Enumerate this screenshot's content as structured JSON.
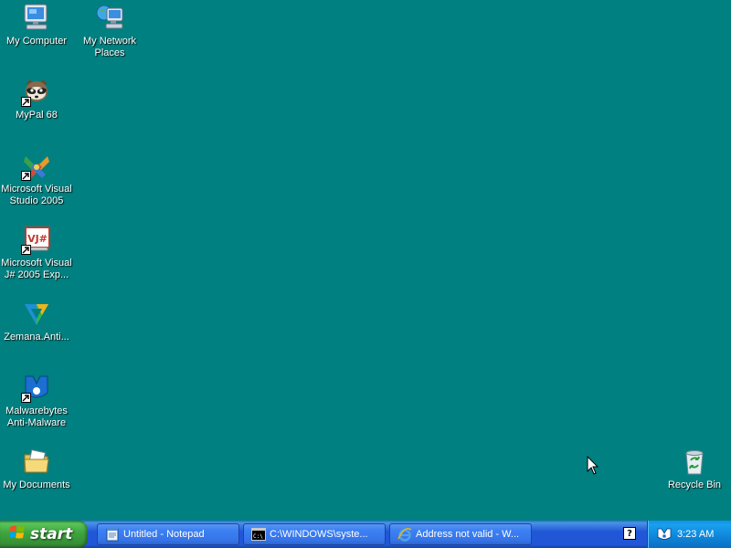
{
  "desktop": {
    "background": "#008080",
    "icons": [
      {
        "id": "my-computer",
        "label": "My Computer",
        "icon": "computer-icon"
      },
      {
        "id": "my-network-places",
        "label": "My Network\nPlaces",
        "icon": "network-icon"
      },
      {
        "id": "mypal-68",
        "label": "MyPal 68",
        "icon": "raccoon-icon",
        "shortcut": true
      },
      {
        "id": "microsoft-visual-studio-2005",
        "label": "Microsoft Visual\nStudio 2005",
        "icon": "visual-studio-icon",
        "shortcut": true
      },
      {
        "id": "microsoft-visual-jsharp-2005",
        "label": "Microsoft Visual\nJ# 2005 Exp...",
        "icon": "vjsharp-icon",
        "shortcut": true
      },
      {
        "id": "zemana-antimalware",
        "label": "Zemana.Anti...",
        "icon": "zemana-icon"
      },
      {
        "id": "malwarebytes",
        "label": "Malwarebytes\nAnti-Malware",
        "icon": "malwarebytes-icon",
        "shortcut": true
      },
      {
        "id": "my-documents",
        "label": "My Documents",
        "icon": "folder-icon"
      },
      {
        "id": "recycle-bin",
        "label": "Recycle Bin",
        "icon": "recycle-bin-icon"
      }
    ]
  },
  "taskbar": {
    "start_label": "start",
    "tasks": [
      {
        "label": "Untitled - Notepad",
        "icon": "notepad-icon"
      },
      {
        "label": "C:\\WINDOWS\\syste...",
        "icon": "console-icon"
      },
      {
        "label": "Address not valid - W...",
        "icon": "ie-icon"
      }
    ],
    "help_glyph": "?",
    "clock": "3:23 AM"
  }
}
